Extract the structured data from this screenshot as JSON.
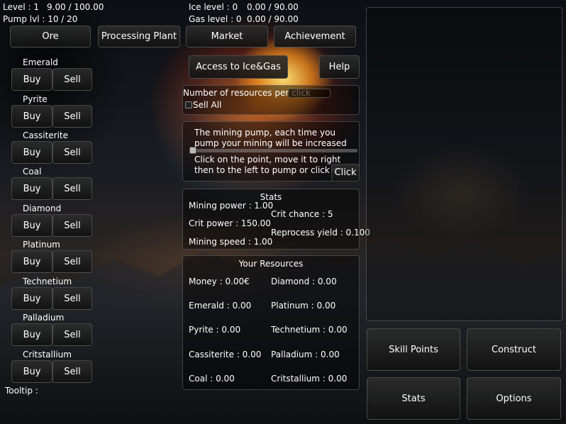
{
  "hud": {
    "level_label": "Level : 1",
    "level_progress": "9.00 / 100.00",
    "pump_label": "Pump lvl : 10 / 20",
    "ice_label": "Ice level : 0",
    "ice_progress": "0.00 / 90.00",
    "gas_label": "Gas level : 0",
    "gas_progress": "0.00 / 90.00"
  },
  "tabs": [
    "Ore",
    "Processing Plant",
    "Market",
    "Achievement"
  ],
  "actions": {
    "access": "Access to Ice&Gas",
    "help": "Help"
  },
  "ores": [
    {
      "name": "Emerald",
      "buy": "Buy",
      "sell": "Sell"
    },
    {
      "name": "Pyrite",
      "buy": "Buy",
      "sell": "Sell"
    },
    {
      "name": "Cassiterite",
      "buy": "Buy",
      "sell": "Sell"
    },
    {
      "name": "Coal",
      "buy": "Buy",
      "sell": "Sell"
    },
    {
      "name": "Diamond",
      "buy": "Buy",
      "sell": "Sell"
    },
    {
      "name": "Platinum",
      "buy": "Buy",
      "sell": "Sell"
    },
    {
      "name": "Technetium",
      "buy": "Buy",
      "sell": "Sell"
    },
    {
      "name": "Palladium",
      "buy": "Buy",
      "sell": "Sell"
    },
    {
      "name": "Critstallium",
      "buy": "Buy",
      "sell": "Sell"
    }
  ],
  "tooltip": "Tooltip :",
  "resources_per_click": {
    "label": "Number of resources per click",
    "value": "",
    "sell_all": "Sell All"
  },
  "pump": {
    "line1": "The mining pump, each time you",
    "line2": "pump your mining will be increased",
    "line3": "Click on the point, move it to right",
    "line4": "then to the left to pump or click on",
    "click_button": "Click"
  },
  "stats": {
    "title": "Stats",
    "mining_power": "Mining power : 1.00",
    "crit_chance": "Crit chance : 5",
    "crit_power": "Crit power : 150.00",
    "reprocess_yield": "Reprocess yield : 0.100",
    "mining_speed": "Mining speed : 1.00"
  },
  "resources": {
    "title": "Your Resources",
    "money": "Money : 0.00€",
    "diamond": "Diamond : 0.00",
    "emerald": "Emerald : 0.00",
    "platinum": "Platinum : 0.00",
    "pyrite": "Pyrite : 0.00",
    "technetium": "Technetium : 0.00",
    "cassiterite": "Cassiterite : 0.00",
    "palladium": "Palladium : 0.00",
    "coal": "Coal : 0.00",
    "critstallium": "Critstallium : 0.00"
  },
  "menu": {
    "skill_points": "Skill Points",
    "construct": "Construct",
    "stats": "Stats",
    "options": "Options"
  }
}
